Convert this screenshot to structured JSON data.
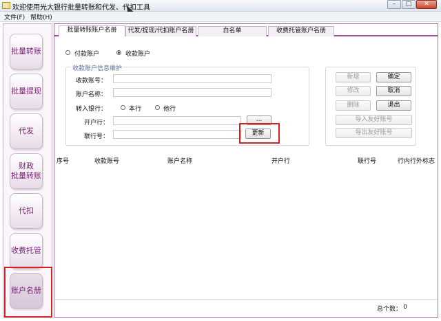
{
  "window": {
    "title": "欢迎使用光大银行批量转账和代发、代扣工具",
    "controls": [
      "–",
      "□",
      "✕"
    ]
  },
  "menu": [
    "文件(F)",
    "帮助(H)"
  ],
  "sidebar": {
    "items": [
      {
        "label": "批量转账"
      },
      {
        "label": "批量提现"
      },
      {
        "label": "代发"
      },
      {
        "label": "财政\n批量转账"
      },
      {
        "label": "代扣"
      },
      {
        "label": "收费托管"
      },
      {
        "label": "账户名册",
        "active": true
      }
    ]
  },
  "tabs": [
    "批量转账账户名册",
    "代发/提现/代扣账户名册",
    "白名单",
    "收费托管账户名册"
  ],
  "account_type": {
    "options": [
      "付款账户",
      "收款账户"
    ],
    "selected": "收款账户"
  },
  "form": {
    "group_title": "收款账户信息维护",
    "labels": {
      "account_no": "收款账号：",
      "account_name": "账户名称：",
      "bank": "转入银行：",
      "open_bank": "开户行：",
      "bank_code": "联行号："
    },
    "bank_options": [
      "本行",
      "他行"
    ],
    "browse_label": "...",
    "update_label": "更新"
  },
  "actions": {
    "add": "新增",
    "confirm": "确定",
    "modify": "修改",
    "cancel": "取消",
    "delete": "删除",
    "exit": "退出",
    "import": "导入友好账号",
    "export": "导出友好账号"
  },
  "table": {
    "columns": [
      "序号",
      "收款账号",
      "账户名称",
      "开户行",
      "联行号",
      "行内行外标志"
    ]
  },
  "footer": {
    "total_label": "总个数：",
    "total_value": "0"
  },
  "colors": {
    "accent": "#a34aa1",
    "nav_text": "#7a1f76",
    "highlight_box": "#d0231e"
  }
}
